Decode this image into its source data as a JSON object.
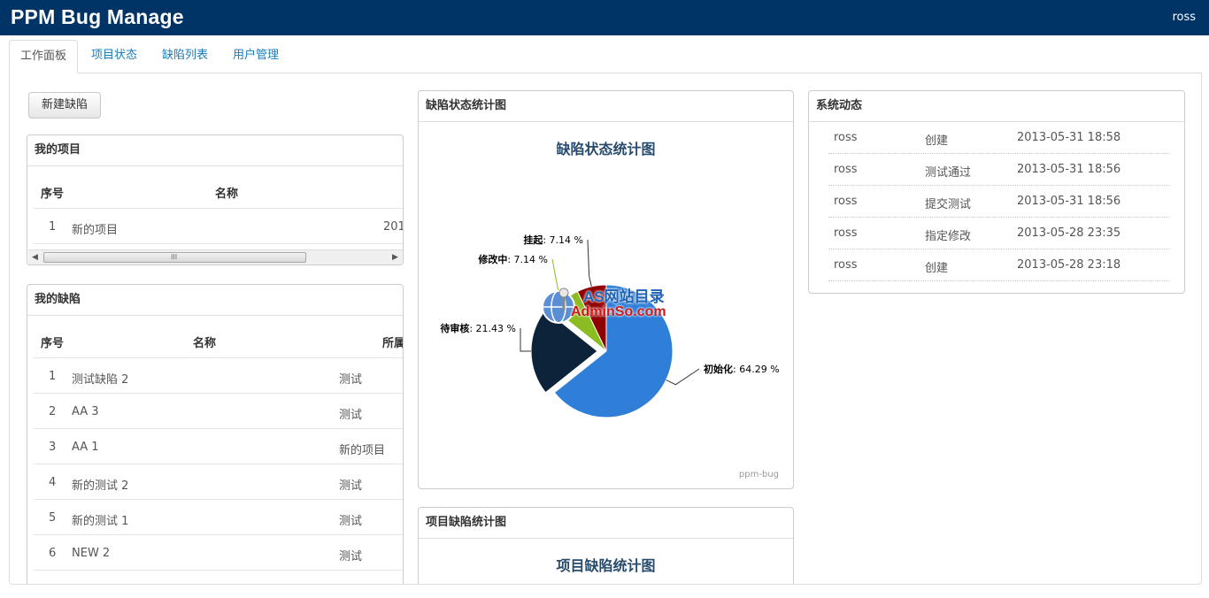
{
  "app": {
    "title": "PPM Bug Manage",
    "user": "ross"
  },
  "tabs": [
    {
      "label": "工作面板",
      "active": true
    },
    {
      "label": "项目状态",
      "active": false
    },
    {
      "label": "缺陷列表",
      "active": false
    },
    {
      "label": "用户管理",
      "active": false
    }
  ],
  "new_bug_button": "新建缺陷",
  "my_projects": {
    "title": "我的项目",
    "headers": [
      "序号",
      "名称"
    ],
    "rows": [
      {
        "no": "1",
        "name": "新的项目",
        "extra": "201"
      }
    ]
  },
  "my_bugs": {
    "title": "我的缺陷",
    "headers": [
      "序号",
      "名称",
      "所属"
    ],
    "rows": [
      {
        "no": "1",
        "name": "测试缺陷 2",
        "project": "测试"
      },
      {
        "no": "2",
        "name": "AA 3",
        "project": "测试"
      },
      {
        "no": "3",
        "name": "AA 1",
        "project": "新的项目"
      },
      {
        "no": "4",
        "name": "新的测试 2",
        "project": "测试"
      },
      {
        "no": "5",
        "name": "新的测试 1",
        "project": "测试"
      },
      {
        "no": "6",
        "name": "NEW 2",
        "project": "测试"
      }
    ]
  },
  "status_chart_panel": {
    "title": "缺陷状态统计图"
  },
  "project_chart_panel": {
    "title": "项目缺陷统计图",
    "chart_title": "项目缺陷统计图"
  },
  "watermark": {
    "line1": "AS网站目录",
    "line2": "AdminSo.com"
  },
  "chart_data": {
    "type": "pie",
    "title": "缺陷状态统计图",
    "credit": "ppm-bug",
    "slices": [
      {
        "name": "初始化",
        "value": 64.29,
        "label": "64.29 %",
        "color": "#2f7ed8"
      },
      {
        "name": "待审核",
        "value": 21.43,
        "label": "21.43 %",
        "color": "#0d233a"
      },
      {
        "name": "修改中",
        "value": 7.14,
        "label": "7.14 %",
        "color": "#8bbc21"
      },
      {
        "name": "挂起",
        "value": 7.14,
        "label": "7.14 %",
        "color": "#910000"
      }
    ]
  },
  "activity": {
    "title": "系统动态",
    "rows": [
      {
        "user": "ross",
        "action": "创建",
        "time": "2013-05-31 18:58"
      },
      {
        "user": "ross",
        "action": "测试通过",
        "time": "2013-05-31 18:56"
      },
      {
        "user": "ross",
        "action": "提交测试",
        "time": "2013-05-31 18:56"
      },
      {
        "user": "ross",
        "action": "指定修改",
        "time": "2013-05-28 23:35"
      },
      {
        "user": "ross",
        "action": "创建",
        "time": "2013-05-28 23:18"
      }
    ]
  }
}
